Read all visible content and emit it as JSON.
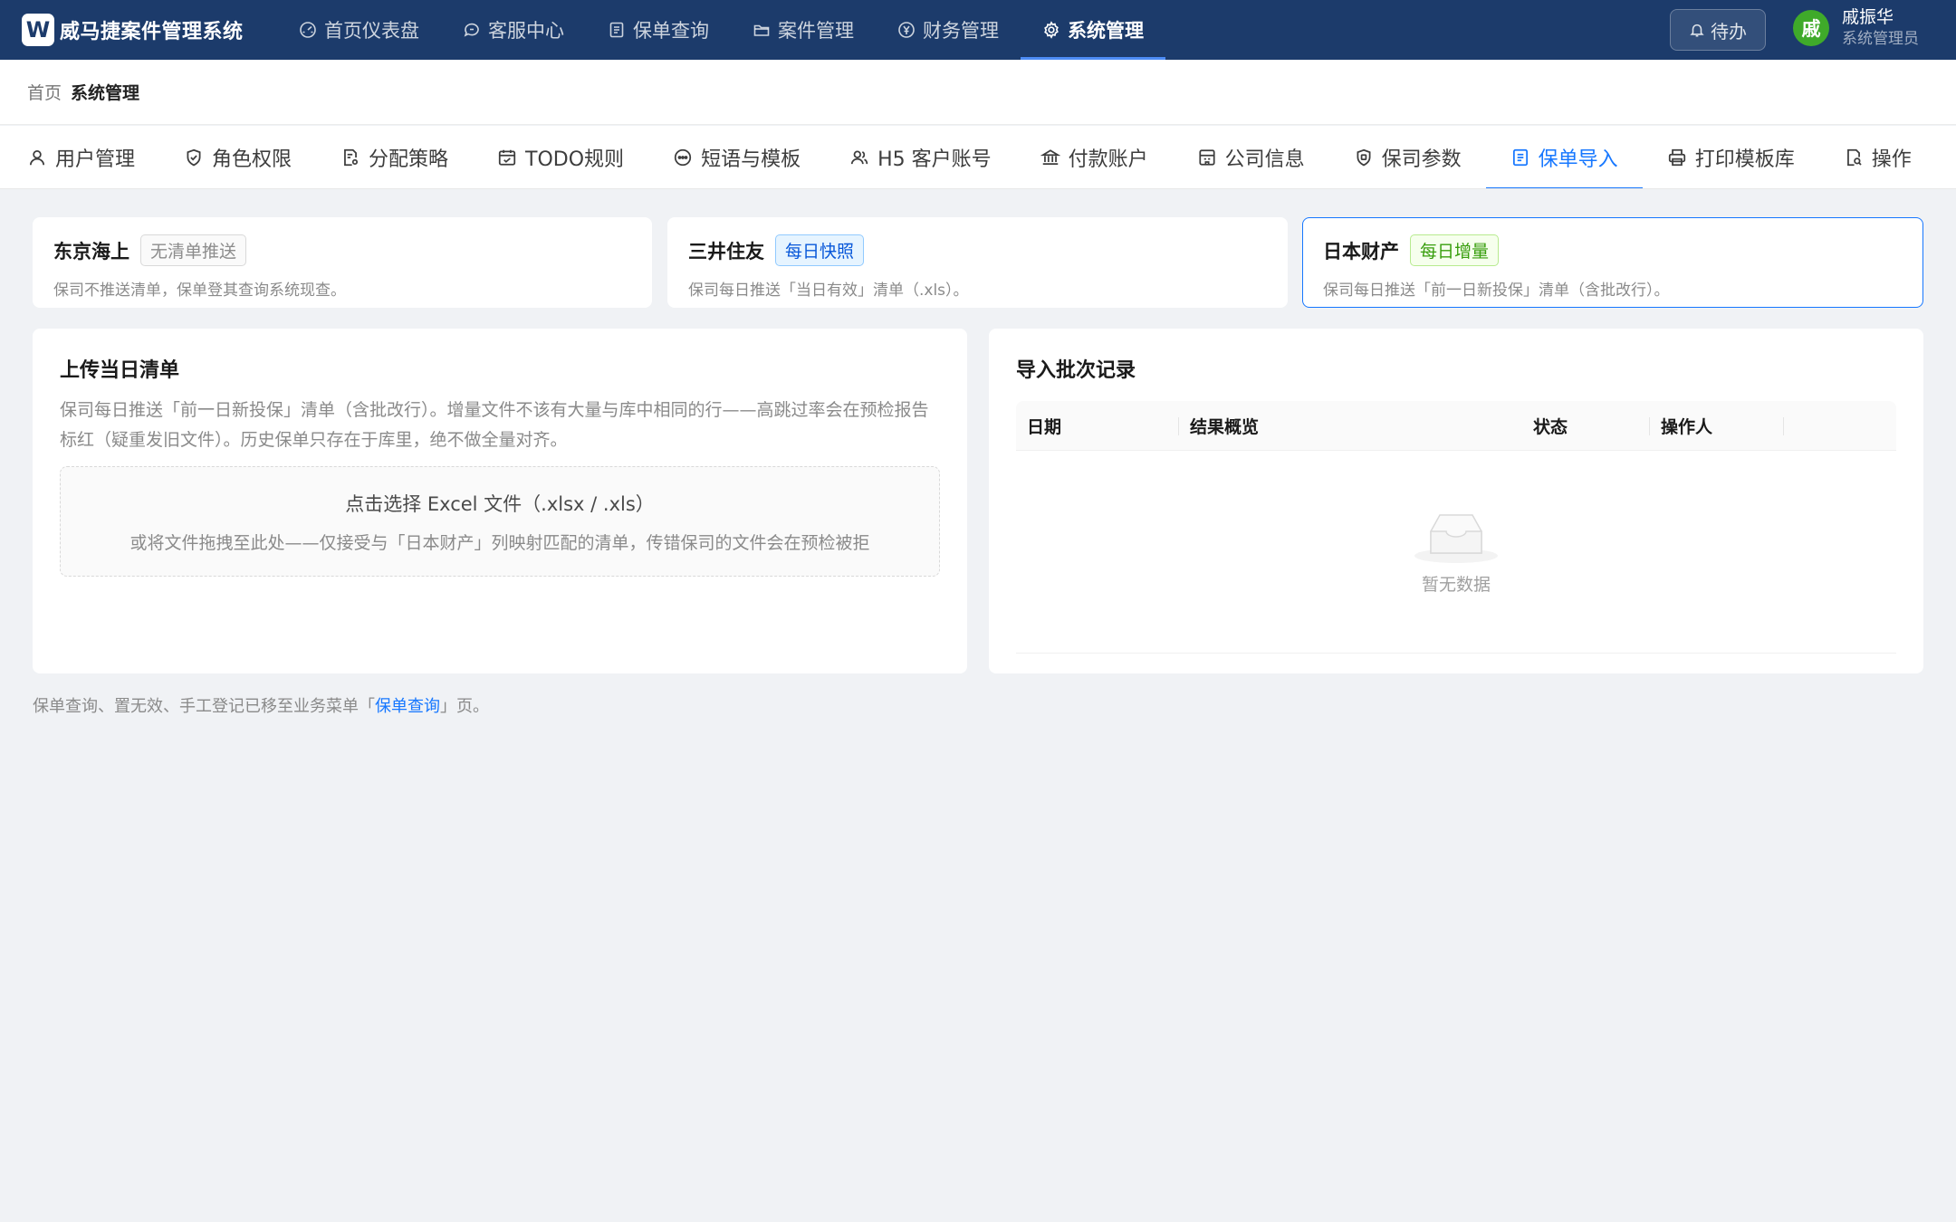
{
  "app": {
    "logo_letter": "W",
    "title": "威马捷案件管理系统"
  },
  "nav": [
    {
      "label": "首页仪表盘",
      "icon": "dashboard-icon"
    },
    {
      "label": "客服中心",
      "icon": "chat-icon"
    },
    {
      "label": "保单查询",
      "icon": "document-list-icon"
    },
    {
      "label": "案件管理",
      "icon": "folder-icon"
    },
    {
      "label": "财务管理",
      "icon": "yen-circle-icon"
    },
    {
      "label": "系统管理",
      "icon": "gear-icon",
      "active": true
    }
  ],
  "header": {
    "todo_label": "待办",
    "user": {
      "avatar_char": "戚",
      "name": "戚振华",
      "role": "系统管理员"
    }
  },
  "breadcrumb": {
    "home": "首页",
    "current": "系统管理"
  },
  "tabs": [
    {
      "label": "用户管理",
      "icon": "user-icon"
    },
    {
      "label": "角色权限",
      "icon": "shield-check-icon"
    },
    {
      "label": "分配策略",
      "icon": "file-settings-icon"
    },
    {
      "label": "TODO规则",
      "icon": "calendar-check-icon"
    },
    {
      "label": "短语与模板",
      "icon": "message-dots-icon"
    },
    {
      "label": "H5 客户账号",
      "icon": "users-icon"
    },
    {
      "label": "付款账户",
      "icon": "bank-icon"
    },
    {
      "label": "公司信息",
      "icon": "building-icon"
    },
    {
      "label": "保司参数",
      "icon": "shield-badge-icon"
    },
    {
      "label": "保单导入",
      "icon": "document-list-icon",
      "active": true
    },
    {
      "label": "打印模板库",
      "icon": "printer-icon"
    },
    {
      "label": "操作",
      "icon": "file-search-icon"
    }
  ],
  "insurers": [
    {
      "name": "东京海上",
      "badge": "无清单推送",
      "badge_style": "gray",
      "desc": "保司不推送清单，保单登其查询系统现查。"
    },
    {
      "name": "三井住友",
      "badge": "每日快照",
      "badge_style": "blue",
      "desc": "保司每日推送「当日有效」清单（.xls）。"
    },
    {
      "name": "日本财产",
      "badge": "每日增量",
      "badge_style": "green",
      "desc": "保司每日推送「前一日新投保」清单（含批改行）。",
      "active": true
    }
  ],
  "upload": {
    "title": "上传当日清单",
    "desc": "保司每日推送「前一日新投保」清单（含批改行）。增量文件不该有大量与库中相同的行——高跳过率会在预检报告标红（疑重发旧文件）。历史保单只存在于库里，绝不做全量对齐。",
    "drop_main": "点击选择 Excel 文件（.xlsx / .xls）",
    "drop_sub": "或将文件拖拽至此处——仅接受与「日本财产」列映射匹配的清单，传错保司的文件会在预检被拒"
  },
  "records": {
    "title": "导入批次记录",
    "columns": [
      "日期",
      "结果概览",
      "状态",
      "操作人"
    ],
    "empty_text": "暂无数据"
  },
  "footnote": {
    "prefix": "保单查询、置无效、手工登记已移至业务菜单「",
    "link": "保单查询",
    "suffix": "」页。"
  },
  "colors": {
    "header_bg": "#1c3b6b",
    "accent": "#1677ff",
    "avatar_bg": "#3faa2a",
    "page_bg": "#f0f2f5"
  }
}
